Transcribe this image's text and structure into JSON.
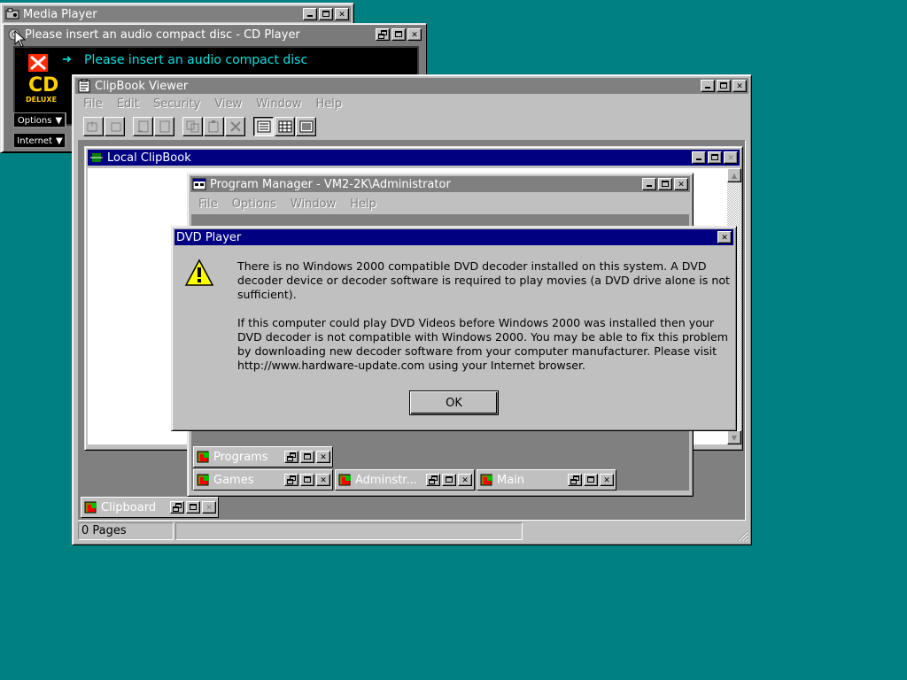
{
  "media_player": {
    "title": "Media Player"
  },
  "cd_player": {
    "title": "Please insert an audio compact disc - CD Player",
    "display_text": "Please insert an audio compact disc",
    "logo_text": "CD",
    "logo_sub": "DELUXE",
    "options_label": "Options",
    "internet_label": "Internet"
  },
  "clipbook": {
    "title": "ClipBook Viewer",
    "menu": [
      "File",
      "Edit",
      "Security",
      "View",
      "Window",
      "Help"
    ],
    "local": {
      "title": "Local ClipBook"
    },
    "clipboard_label": "Clipboard",
    "status_pages": "0 Pages"
  },
  "program_manager": {
    "title": "Program Manager - VM2-2K\\Administrator",
    "menu": [
      "File",
      "Options",
      "Window",
      "Help"
    ],
    "groups": [
      "Programs",
      "Games",
      "Adminstr...",
      "Main"
    ]
  },
  "dialog": {
    "title": "DVD Player",
    "paragraph1": "There is no Windows 2000 compatible DVD decoder installed on this system. A DVD decoder device or decoder software is required to play movies (a DVD drive alone is not sufficient).",
    "paragraph2": "If this computer could play DVD Videos before Windows 2000 was installed then your DVD decoder is not compatible with Windows 2000.  You may be able to fix this problem by downloading new decoder software from your computer manufacturer.  Please visit http://www.hardware-update.com using your Internet browser.",
    "ok_label": "OK"
  },
  "colors": {
    "desktop": "#008080",
    "active_title": "#000080",
    "inactive_title": "#808080",
    "cd_text": "#00e0e0"
  }
}
